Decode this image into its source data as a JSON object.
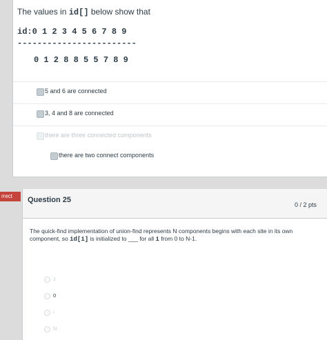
{
  "q24": {
    "prompt_prefix": "The values in ",
    "prompt_code": "id[]",
    "prompt_suffix": " below show that",
    "id_row": "id:0 1 2 3 4 5 6 7 8 9",
    "dashes": "------------------------",
    "values_row": "0 1 2 8 8 5 5 7 8 9",
    "answers": [
      {
        "label": "5 and 6 are connected",
        "selected": true
      },
      {
        "label": "3, 4 and 8 are connected",
        "selected": true
      },
      {
        "label": "there are three connected components",
        "selected": false
      },
      {
        "label": "there are two connect components",
        "selected": true
      }
    ]
  },
  "tag": {
    "label": "rrect"
  },
  "q25": {
    "title": "Question 25",
    "points": "0 / 2 pts",
    "text_part1": "The quick-find implementation of union-find represents N components begins with each site in its own component, so ",
    "text_code1": "id[i]",
    "text_part2": " is initialized to ___ for all ",
    "text_code2": "i",
    "text_part3": " from 0 to N-1.",
    "options": [
      {
        "label": "1"
      },
      {
        "label": "0"
      },
      {
        "label": "i"
      },
      {
        "label": "N"
      }
    ]
  }
}
